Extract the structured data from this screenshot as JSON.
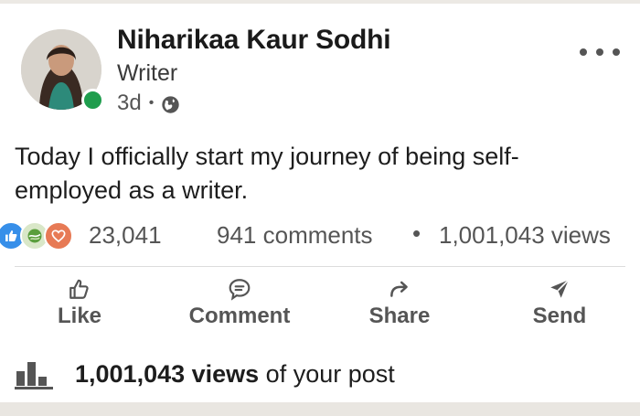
{
  "author": {
    "name": "Niharikaa Kaur Sodhi",
    "headline": "Writer",
    "age": "3d",
    "separator": "•",
    "visibility_icon": "globe-icon",
    "presence_color": "#1f9d4d"
  },
  "post": {
    "text": "Today I officially start my journey of being self-employed as a writer."
  },
  "social": {
    "reaction_icons": [
      "like-icon",
      "support-icon",
      "love-icon"
    ],
    "reactions_count": "23,041",
    "comments_label": "941 comments",
    "separator": "•",
    "views_label": "1,001,043 views"
  },
  "actions": {
    "like": "Like",
    "comment": "Comment",
    "share": "Share",
    "send": "Send"
  },
  "analytics": {
    "icon": "bar-chart-icon",
    "views_bold": "1,001,043 views",
    "suffix": " of your post"
  },
  "colors": {
    "like_blue": "#378fe9",
    "love_orange": "#e77a55",
    "text_gray": "#555555"
  }
}
